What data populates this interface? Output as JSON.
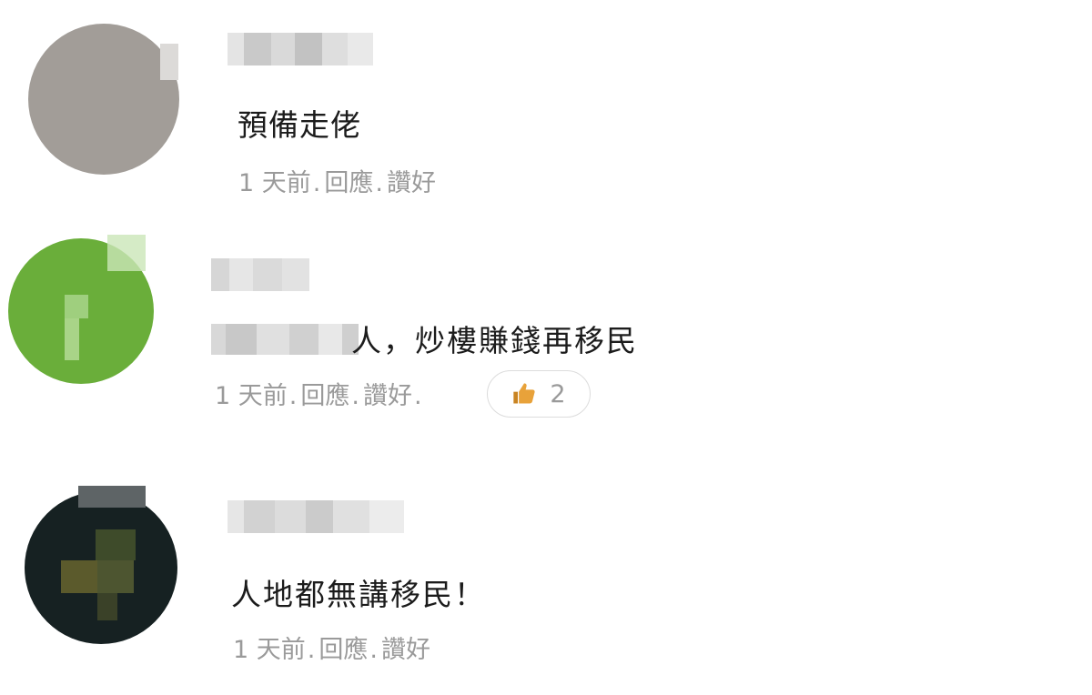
{
  "comments": [
    {
      "text": "預備走佬",
      "time": "1 天前",
      "reply_label": "回應",
      "like_label": "讚好"
    },
    {
      "text_visible": "人，炒樓賺錢再移民",
      "time": "1 天前",
      "reply_label": "回應",
      "like_label": "讚好",
      "reaction_count": "2"
    },
    {
      "text": "人地都無講移民！",
      "time": "1 天前",
      "reply_label": "回應",
      "like_label": "讚好"
    }
  ],
  "separator": ".",
  "colors": {
    "meta_text": "#9a9a9a",
    "body_text": "#1c1c1c",
    "like_icon": "#e8a23a"
  }
}
